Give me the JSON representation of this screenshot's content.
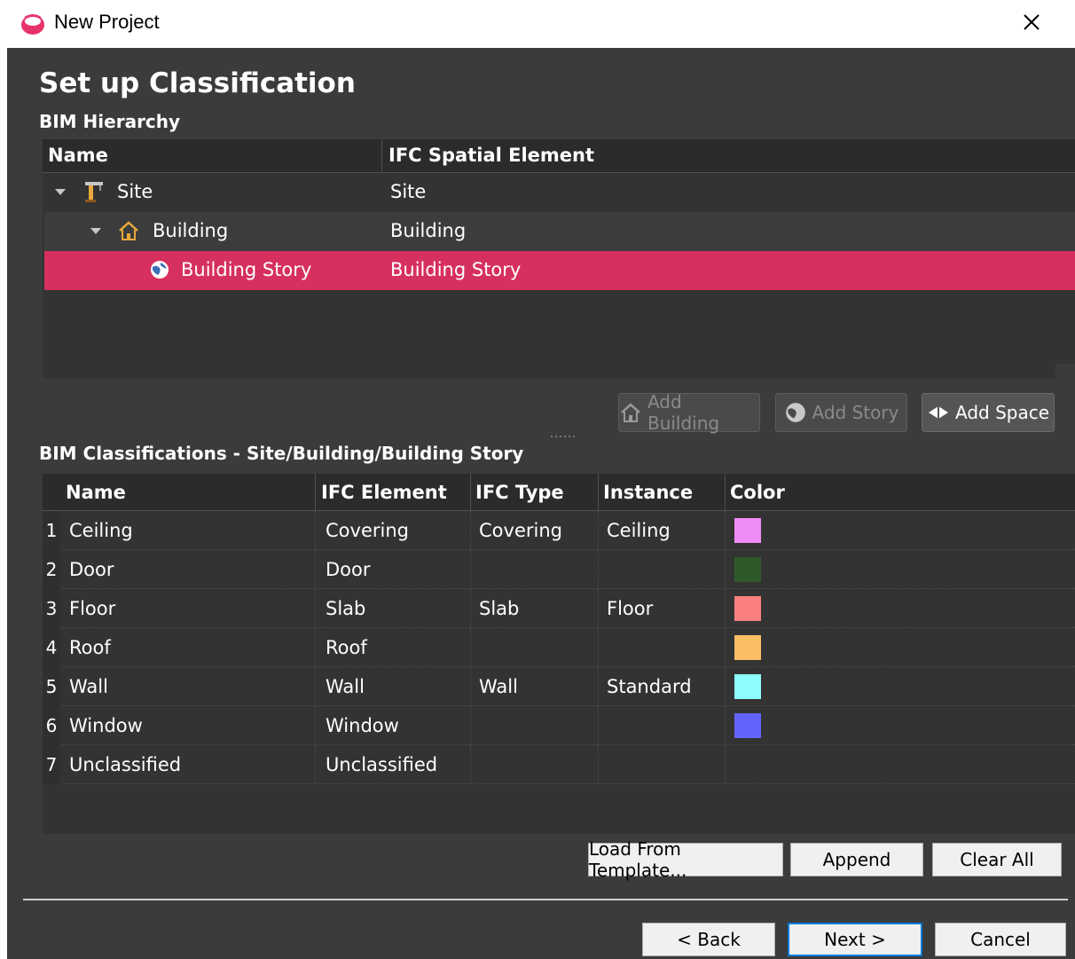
{
  "window": {
    "title": "New Project",
    "close_icon": "close-icon"
  },
  "page": {
    "heading": "Set up Classification",
    "hierarchy_label": "BIM Hierarchy",
    "classifications_label": "BIM Classifications - Site/Building/Building Story"
  },
  "hierarchy": {
    "columns": [
      "Name",
      "IFC Spatial Element"
    ],
    "rows": [
      {
        "name": "Site",
        "ifc": "Site",
        "icon": "site-crane-icon",
        "expanded": true
      },
      {
        "name": "Building",
        "ifc": "Building",
        "icon": "building-house-icon",
        "expanded": true
      },
      {
        "name": "Building Story",
        "ifc": "Building Story",
        "icon": "story-globe-icon",
        "selected": true
      }
    ],
    "buttons": {
      "add_building": "Add Building",
      "add_story": "Add Story",
      "add_space": "Add Space"
    }
  },
  "classifications": {
    "columns": [
      "Name",
      "IFC Element",
      "IFC Type",
      "Instance",
      "Color"
    ],
    "rows": [
      {
        "num": "1",
        "name": "Ceiling",
        "element": "Covering",
        "type": "Covering",
        "instance": "Ceiling",
        "color": "#f08cf6"
      },
      {
        "num": "2",
        "name": "Door",
        "element": "Door",
        "type": "",
        "instance": "",
        "color": "#2e5a2a"
      },
      {
        "num": "3",
        "name": "Floor",
        "element": "Slab",
        "type": "Slab",
        "instance": "Floor",
        "color": "#fa8080"
      },
      {
        "num": "4",
        "name": "Roof",
        "element": "Roof",
        "type": "",
        "instance": "",
        "color": "#fcbe64"
      },
      {
        "num": "5",
        "name": "Wall",
        "element": "Wall",
        "type": "Wall",
        "instance": "Standard",
        "color": "#8cfcfc"
      },
      {
        "num": "6",
        "name": "Window",
        "element": "Window",
        "type": "",
        "instance": "",
        "color": "#6464fc"
      },
      {
        "num": "7",
        "name": "Unclassified",
        "element": "Unclassified",
        "type": "",
        "instance": "",
        "color": ""
      }
    ],
    "buttons": {
      "load_template": "Load From Template...",
      "append": "Append",
      "clear_all": "Clear All"
    }
  },
  "footer": {
    "back": "< Back",
    "next": "Next >",
    "cancel": "Cancel"
  }
}
